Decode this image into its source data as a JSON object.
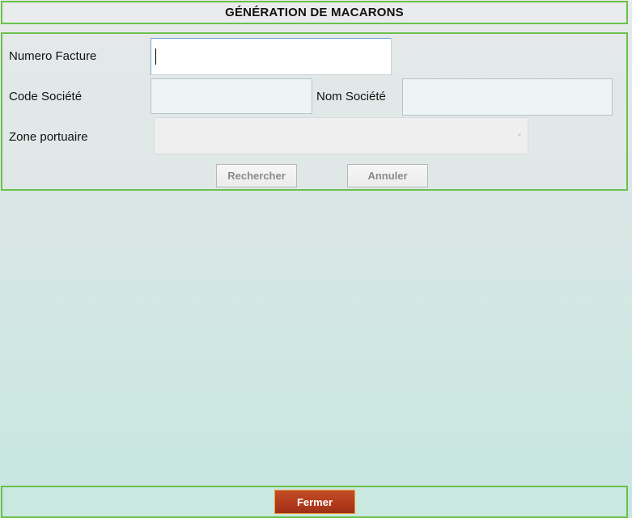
{
  "title": "GÉNÉRATION DE MACARONS",
  "form": {
    "numero_facture": {
      "label": "Numero Facture",
      "value": ""
    },
    "code_societe": {
      "label": "Code Société",
      "value": ""
    },
    "nom_societe": {
      "label": "Nom Société",
      "value": ""
    },
    "zone_portuaire": {
      "label": "Zone portuaire",
      "selected": ""
    }
  },
  "buttons": {
    "rechercher": "Rechercher",
    "annuler": "Annuler",
    "fermer": "Fermer"
  },
  "icons": {
    "dropdown": "chevron-down-icon"
  },
  "colors": {
    "panel_border": "#6ac14a",
    "fermer_bg": "#b23b1c",
    "fermer_border": "#e7a23a",
    "active_field_border": "#7aa6d9"
  }
}
